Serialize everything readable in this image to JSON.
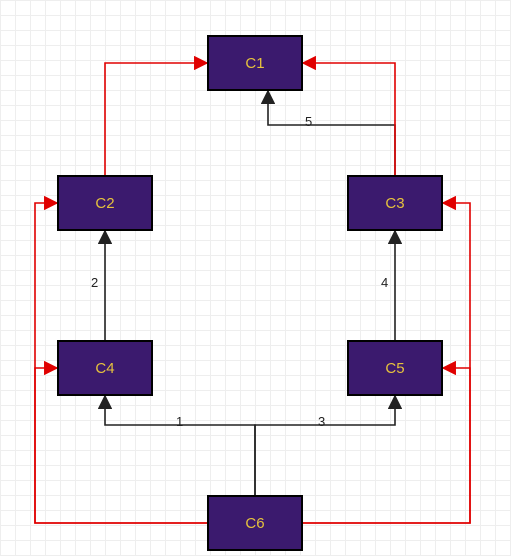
{
  "nodes": {
    "c1": {
      "label": "C1"
    },
    "c2": {
      "label": "C2"
    },
    "c3": {
      "label": "C3"
    },
    "c4": {
      "label": "C4"
    },
    "c5": {
      "label": "C5"
    },
    "c6": {
      "label": "C6"
    }
  },
  "edges": [
    {
      "from": "C6",
      "to": "C4",
      "label": "1",
      "color": "black"
    },
    {
      "from": "C4",
      "to": "C2",
      "label": "2",
      "color": "black"
    },
    {
      "from": "C6",
      "to": "C5",
      "label": "3",
      "color": "black"
    },
    {
      "from": "C5",
      "to": "C3",
      "label": "4",
      "color": "black"
    },
    {
      "from": "C3",
      "to": "C1",
      "label": "5",
      "color": "black"
    },
    {
      "from": "C6",
      "to": "C4",
      "label": "",
      "color": "red"
    },
    {
      "from": "C6",
      "to": "C2",
      "label": "",
      "color": "red"
    },
    {
      "from": "C2",
      "to": "C1",
      "label": "",
      "color": "red"
    },
    {
      "from": "C6",
      "to": "C5",
      "label": "",
      "color": "red"
    },
    {
      "from": "C6",
      "to": "C3",
      "label": "",
      "color": "red"
    },
    {
      "from": "C3",
      "to": "C1",
      "label": "",
      "color": "red"
    }
  ],
  "colors": {
    "node_fill": "#3b1a6e",
    "node_border": "#000000",
    "node_text": "#e6c23d",
    "edge_default": "#222222",
    "edge_highlight": "#e00000",
    "grid_minor": "#eeeeee",
    "grid_major": "#dddddd"
  }
}
